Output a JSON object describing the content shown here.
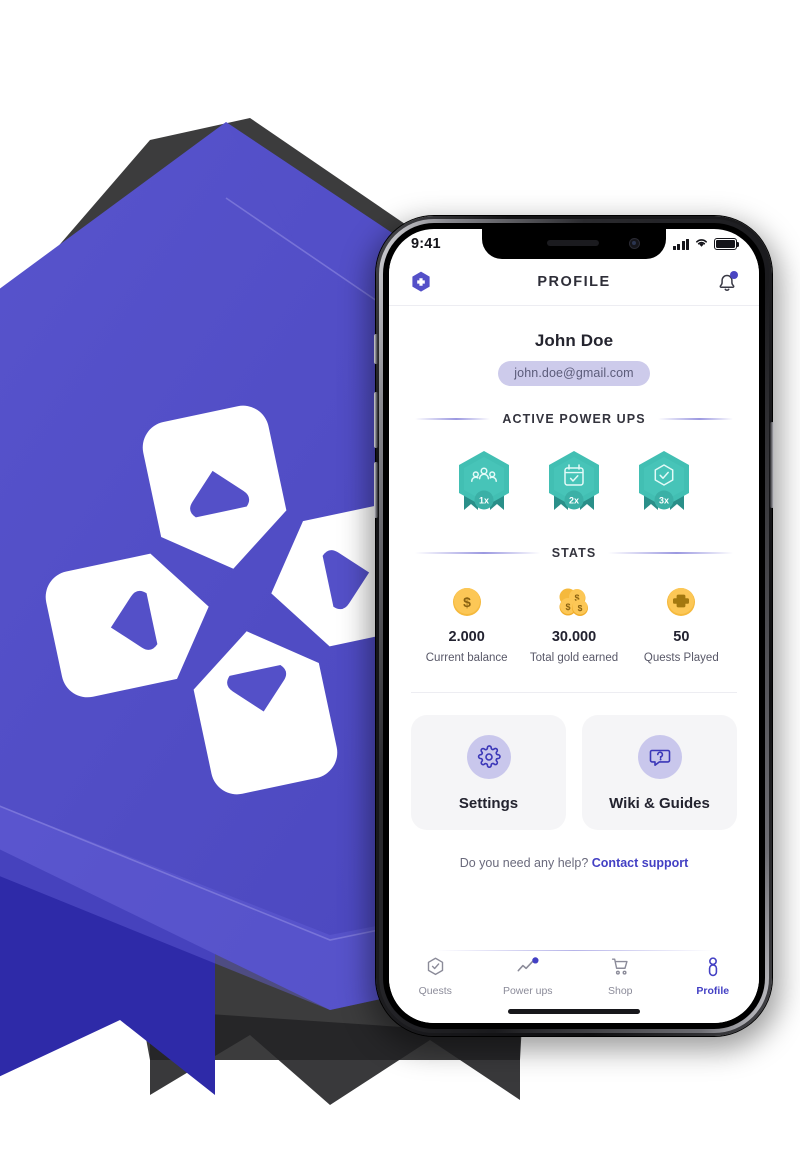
{
  "background": {
    "brand_color": "#5450c8",
    "brand_color_dark": "#2e2aa8",
    "logo_name": "dpad-logo"
  },
  "phone": {
    "status_bar": {
      "time": "9:41",
      "signal_icon": "cellular-signal-icon",
      "wifi_icon": "wifi-icon",
      "battery_icon": "battery-full-icon"
    },
    "home_indicator": "home-indicator"
  },
  "header": {
    "logo_icon": "app-hexagon-logo-icon",
    "title": "PROFILE",
    "bell_icon": "notification-bell-icon",
    "has_notification": true
  },
  "profile": {
    "name": "John Doe",
    "email": "john.doe@gmail.com"
  },
  "power_ups": {
    "section_title": "ACTIVE POWER UPS",
    "items": [
      {
        "icon": "group-people-icon",
        "multiplier": "1x"
      },
      {
        "icon": "calendar-check-icon",
        "multiplier": "2x"
      },
      {
        "icon": "hexagon-check-icon",
        "multiplier": "3x"
      }
    ]
  },
  "stats": {
    "section_title": "STATS",
    "items": [
      {
        "icon": "single-gold-coin-icon",
        "value": "2.000",
        "label": "Current balance"
      },
      {
        "icon": "gold-coins-stack-icon",
        "value": "30.000",
        "label": "Total gold earned"
      },
      {
        "icon": "gold-dpad-coin-icon",
        "value": "50",
        "label": "Quests Played"
      }
    ]
  },
  "action_cards": [
    {
      "icon": "gear-icon",
      "label": "Settings"
    },
    {
      "icon": "question-bubble-icon",
      "label": "Wiki & Guides"
    }
  ],
  "help": {
    "text": "Do you need any help?",
    "link_label": "Contact support"
  },
  "bottom_nav": {
    "items": [
      {
        "icon": "hexagon-check-icon",
        "label": "Quests",
        "active": false
      },
      {
        "icon": "trending-up-icon",
        "label": "Power ups",
        "active": false
      },
      {
        "icon": "shopping-cart-icon",
        "label": "Shop",
        "active": false
      },
      {
        "icon": "person-icon",
        "label": "Profile",
        "active": true
      }
    ]
  },
  "theme": {
    "accent_purple": "#4340c4",
    "badge_teal": "#3bb4ab",
    "coin_gold": "#f5b93d",
    "card_bg": "#f5f5f7",
    "pill_bg": "#cdcbeb"
  }
}
